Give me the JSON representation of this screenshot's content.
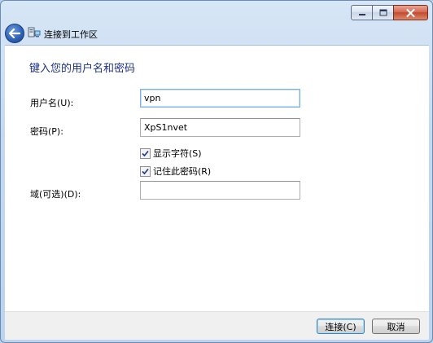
{
  "window": {
    "caption": {
      "minimize_icon": "minimize-icon",
      "maximize_icon": "maximize-icon",
      "close_icon": "close-icon"
    }
  },
  "nav": {
    "back_icon": "back-arrow-icon",
    "network_icon": "network-icon",
    "title": "连接到工作区"
  },
  "form": {
    "heading": "键入您的用户名和密码",
    "username": {
      "label": "用户名(U):",
      "value": "vpn"
    },
    "password": {
      "label": "密码(P):",
      "value": "XpS1nvet"
    },
    "show_chars": {
      "label": "显示字符(S)",
      "checked": true
    },
    "remember_password": {
      "label": "记住此密码(R)",
      "checked": true
    },
    "domain": {
      "label": "域(可选)(D):",
      "value": ""
    }
  },
  "footer": {
    "connect_label": "连接(C)",
    "cancel_label": "取消"
  },
  "colors": {
    "heading": "#1e3287",
    "frame": "#bcd3ee",
    "focus_border": "#7db0e6"
  }
}
